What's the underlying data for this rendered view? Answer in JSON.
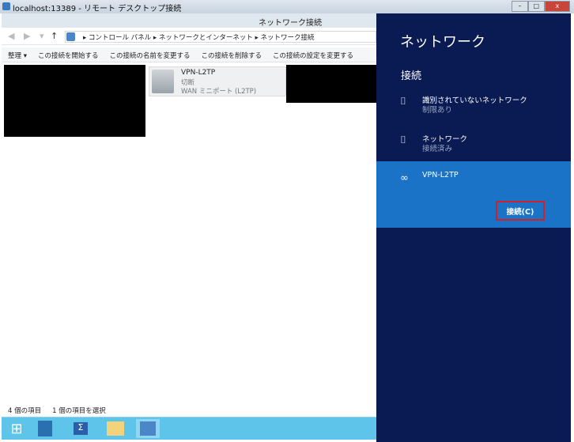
{
  "rdp": {
    "title": "localhost:13389 - リモート デスクトップ接続"
  },
  "window": {
    "title": "ネットワーク接続"
  },
  "address": {
    "path": "▸ コントロール パネル ▸ ネットワークとインターネット ▸ ネットワーク接続"
  },
  "commands": [
    "整理 ▾",
    "この接続を開始する",
    "この接続の名前を変更する",
    "この接続を削除する",
    "この接続の設定を変更する"
  ],
  "item": {
    "name": "VPN-L2TP",
    "status": "切断",
    "device": "WAN ミニポート (L2TP)"
  },
  "status": {
    "count": "4 個の項目",
    "selected": "1 個の項目を選択"
  },
  "charm": {
    "title": "ネットワーク",
    "section": "接続",
    "networks": [
      {
        "name": "識別されていないネットワーク",
        "status": "制限あり"
      },
      {
        "name": "ネットワーク",
        "status": "接続済み"
      }
    ],
    "vpn": {
      "name": "VPN-L2TP",
      "button": "接続(C)"
    }
  },
  "colors": {
    "charm_bg": "#0a1a52",
    "selected_bg": "#1a73c6",
    "highlight": "#d0202a",
    "taskbar": "#5ec4ea"
  }
}
